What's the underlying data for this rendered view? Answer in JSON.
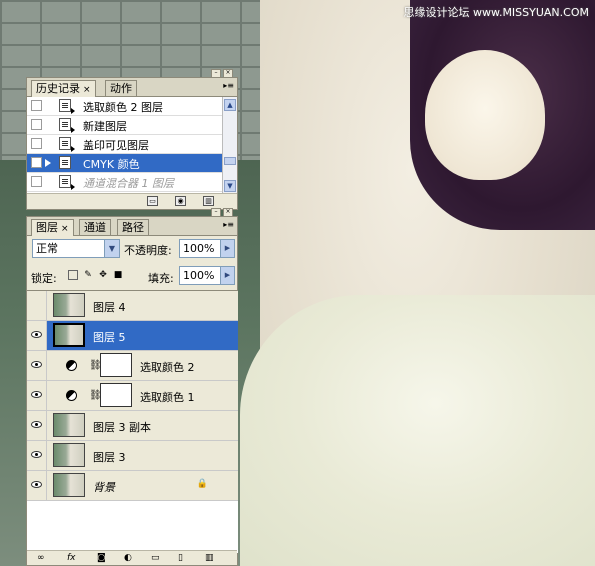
{
  "watermark": "思缘设计论坛 www.MISSYUAN.COM",
  "history_panel": {
    "tabs": [
      {
        "label": "历史记录",
        "close": "×"
      },
      {
        "label": "动作"
      }
    ],
    "items": [
      {
        "label": "选取颜色 2 图层"
      },
      {
        "label": "新建图层"
      },
      {
        "label": "盖印可见图层"
      },
      {
        "label": "CMYK 颜色"
      },
      {
        "label": "通道混合器 1 图层"
      }
    ]
  },
  "layers_panel": {
    "tabs": [
      {
        "label": "图层",
        "close": "×"
      },
      {
        "label": "通道"
      },
      {
        "label": "路径"
      }
    ],
    "blend_mode": "正常",
    "opacity_label": "不透明度:",
    "opacity_value": "100%",
    "lock_label": "锁定:",
    "fill_label": "填充:",
    "fill_value": "100%",
    "layers": [
      {
        "name": "图层 4",
        "type": "pixel",
        "visible": false,
        "selected": false
      },
      {
        "name": "图层 5",
        "type": "pixel",
        "visible": true,
        "selected": true
      },
      {
        "name": "选取颜色 2",
        "type": "adjustment",
        "visible": true,
        "selected": false
      },
      {
        "name": "选取颜色 1",
        "type": "adjustment",
        "visible": true,
        "selected": false
      },
      {
        "name": "图层 3 副本",
        "type": "pixel",
        "visible": true,
        "selected": false
      },
      {
        "name": "图层 3",
        "type": "pixel",
        "visible": true,
        "selected": false
      },
      {
        "name": "背景",
        "type": "background",
        "visible": true,
        "selected": false,
        "locked": true
      }
    ],
    "footer_icons": [
      "link-icon",
      "fx-icon",
      "mask-icon",
      "adjustment-icon",
      "folder-icon",
      "new-layer-icon",
      "trash-icon"
    ]
  },
  "colors": {
    "selection": "#316ac5",
    "panel_bg": "#ece9d8"
  }
}
